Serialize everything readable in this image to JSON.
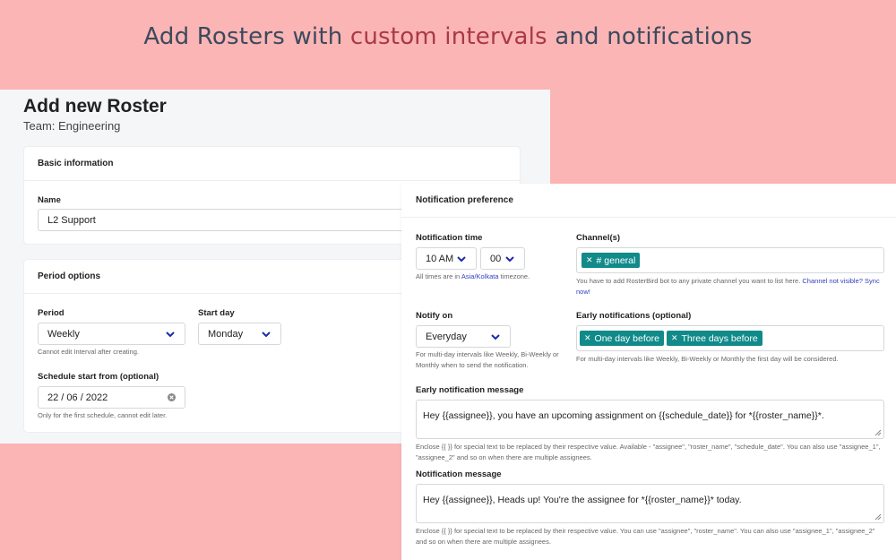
{
  "hero": {
    "part1": "Add Rosters with ",
    "part2": "custom intervals",
    "part3": " and notifications"
  },
  "colors": {
    "background": "#fbb5b5",
    "accent_text": "#a83a45",
    "tag": "#118a8a",
    "link": "#2f3fbf",
    "chevron": "#1c2aa8"
  },
  "page": {
    "title": "Add new Roster",
    "team": "Team: Engineering"
  },
  "basic_info": {
    "header": "Basic information",
    "name_label": "Name",
    "name_value": "L2 Support"
  },
  "period": {
    "header": "Period options",
    "period_label": "Period",
    "period_value": "Weekly",
    "period_hint": "Cannot edit Interval after creating.",
    "start_day_label": "Start day",
    "start_day_value": "Monday",
    "schedule_label": "Schedule start from (optional)",
    "schedule_value": "22 / 06 / 2022",
    "schedule_hint": "Only for the first schedule, cannot edit later."
  },
  "notification": {
    "header": "Notification preference",
    "time_label": "Notification time",
    "hour_value": "10 AM",
    "minute_value": "00",
    "tz_prefix": "All times are in ",
    "tz_link": "Asia/Kolkata",
    "tz_suffix": " timezone.",
    "channels_label": "Channel(s)",
    "channel_tag": "# general",
    "channels_hint": "You have to add RosterBird bot to any private channel you want to list here. ",
    "channels_link": "Channel not visible? Sync now!",
    "notify_on_label": "Notify on",
    "notify_on_value": "Everyday",
    "notify_on_hint": "For multi-day intervals like Weekly, Bi-Weekly or Monthly when to send the notification.",
    "early_label": "Early notifications (optional)",
    "early_tags": [
      "One day before",
      "Three days before"
    ],
    "early_hint": "For multi-day intervals like Weekly, Bi-Weekly or Monthly the first day will be considered.",
    "early_msg_label": "Early notification message",
    "early_msg_value": "Hey {{assignee}}, you have an upcoming assignment on {{schedule_date}} for *{{roster_name}}*.",
    "early_msg_hint": "Enclose {{ }} for special text to be replaced by their respective value. Available - \"assignee\", \"roster_name\", \"schedule_date\". You can also use \"assignee_1\", \"assignee_2\" and so on when there are multiple assignees.",
    "msg_label": "Notification message",
    "msg_value": "Hey {{assignee}}, Heads up! You're the assignee for *{{roster_name}}* today.",
    "msg_hint": "Enclose {{ }} for special text to be replaced by their respective value. You can use \"assignee\", \"roster_name\". You can also use \"assignee_1\", \"assignee_2\" and so on when there are multiple assignees."
  }
}
